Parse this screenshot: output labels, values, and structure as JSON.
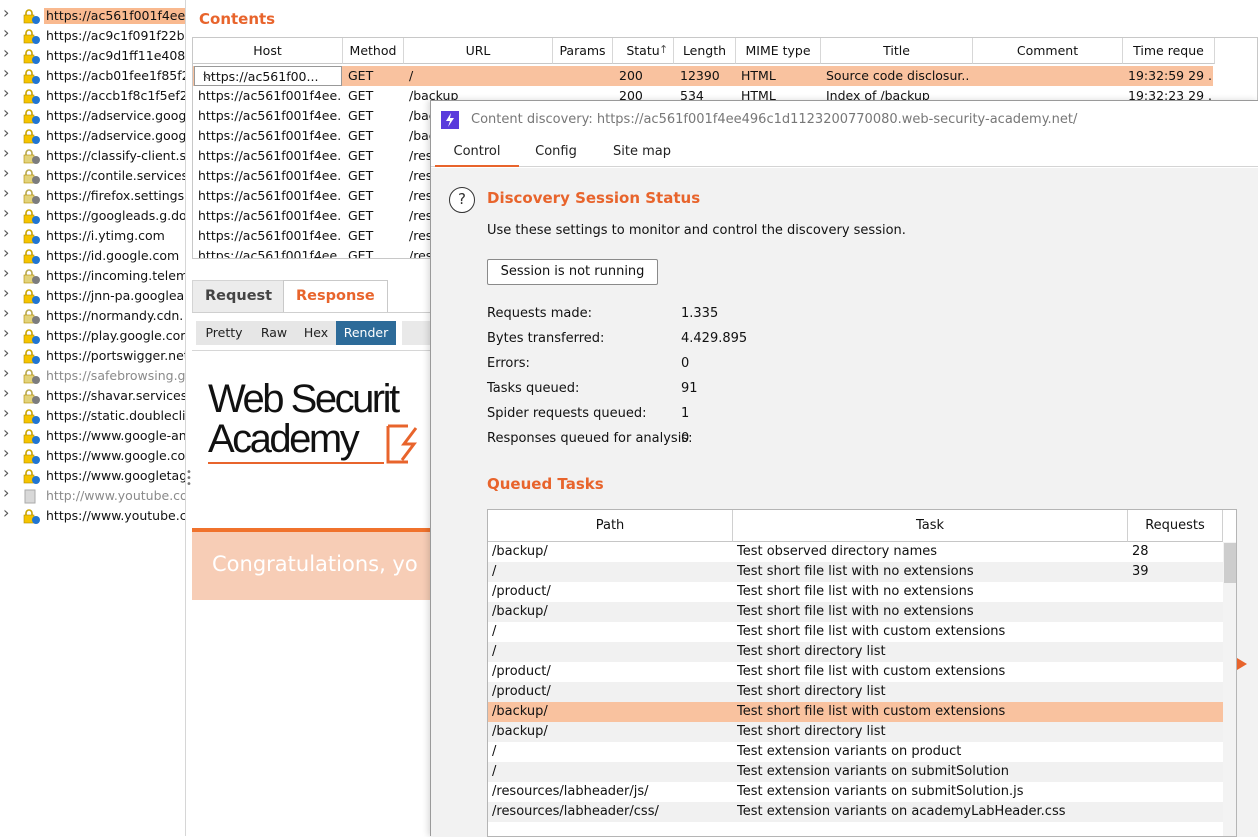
{
  "tree": {
    "items": [
      {
        "label": "https://ac561f001f4ee",
        "selected": true,
        "icon": "lock-icon"
      },
      {
        "label": "https://ac9c1f091f22bl",
        "icon": "lock-icon"
      },
      {
        "label": "https://ac9d1ff11e408",
        "icon": "lock-icon"
      },
      {
        "label": "https://acb01fee1f85f2",
        "icon": "lock-icon"
      },
      {
        "label": "https://accb1f8c1f5ef2",
        "icon": "lock-icon"
      },
      {
        "label": "https://adservice.googl",
        "icon": "lock-icon"
      },
      {
        "label": "https://adservice.googl",
        "icon": "lock-icon"
      },
      {
        "label": "https://classify-client.se",
        "icon": "lock-gray-icon"
      },
      {
        "label": "https://contile.services.",
        "icon": "lock-gray-icon"
      },
      {
        "label": "https://firefox.settings.s",
        "icon": "lock-gray-icon"
      },
      {
        "label": "https://googleads.g.do",
        "icon": "lock-icon"
      },
      {
        "label": "https://i.ytimg.com",
        "icon": "lock-icon"
      },
      {
        "label": "https://id.google.com",
        "icon": "lock-icon"
      },
      {
        "label": "https://incoming.telem",
        "icon": "lock-gray-icon"
      },
      {
        "label": "https://jnn-pa.googlea",
        "icon": "lock-icon"
      },
      {
        "label": "https://normandy.cdn.",
        "icon": "lock-gray-icon"
      },
      {
        "label": "https://play.google.com",
        "icon": "lock-icon"
      },
      {
        "label": "https://portswigger.net",
        "icon": "lock-icon"
      },
      {
        "label": "https://safebrowsing.go",
        "icon": "lock-gray-icon",
        "muted": true
      },
      {
        "label": "https://shavar.services.",
        "icon": "lock-gray-icon"
      },
      {
        "label": "https://static.doubleclic",
        "icon": "lock-icon"
      },
      {
        "label": "https://www.google-an",
        "icon": "lock-icon"
      },
      {
        "label": "https://www.google.co",
        "icon": "lock-icon"
      },
      {
        "label": "https://www.googletag",
        "icon": "lock-icon"
      },
      {
        "label": "http://www.youtube.co",
        "icon": "page-gray-icon",
        "muted": true
      },
      {
        "label": "https://www.youtube.c",
        "icon": "lock-icon"
      }
    ]
  },
  "contents": {
    "title": "Contents",
    "columns": [
      "Host",
      "Method",
      "URL",
      "Params",
      "Statu",
      "Length",
      "MIME type",
      "Title",
      "Comment",
      "Time reque"
    ],
    "sort_indicator": "↑",
    "host_filter": "https://ac561f00...",
    "rows": [
      {
        "host": "",
        "method": "GET",
        "url": "/",
        "status": "200",
        "length": "12390",
        "mime": "HTML",
        "title": "Source code disclosur...",
        "time": "19:32:59 29 ..."
      },
      {
        "host": "https://ac561f001f4ee...",
        "method": "GET",
        "url": "/backup",
        "status": "200",
        "length": "534",
        "mime": "HTML",
        "title": "Index of /backup",
        "time": "19:32:23 29 ..."
      },
      {
        "host": "https://ac561f001f4ee...",
        "method": "GET",
        "url": "/bac",
        "status": "",
        "length": "",
        "mime": "",
        "title": "",
        "time": ""
      },
      {
        "host": "https://ac561f001f4ee...",
        "method": "GET",
        "url": "/bac",
        "status": "",
        "length": "",
        "mime": "",
        "title": "",
        "time": ""
      },
      {
        "host": "https://ac561f001f4ee...",
        "method": "GET",
        "url": "/res",
        "status": "",
        "length": "",
        "mime": "",
        "title": "",
        "time": ""
      },
      {
        "host": "https://ac561f001f4ee...",
        "method": "GET",
        "url": "/res",
        "status": "",
        "length": "",
        "mime": "",
        "title": "",
        "time": ""
      },
      {
        "host": "https://ac561f001f4ee...",
        "method": "GET",
        "url": "/res",
        "status": "",
        "length": "",
        "mime": "",
        "title": "",
        "time": ""
      },
      {
        "host": "https://ac561f001f4ee...",
        "method": "GET",
        "url": "/res",
        "status": "",
        "length": "",
        "mime": "",
        "title": "",
        "time": ""
      },
      {
        "host": "https://ac561f001f4ee...",
        "method": "GET",
        "url": "/res",
        "status": "",
        "length": "",
        "mime": "",
        "title": "",
        "time": ""
      },
      {
        "host": "https://ac561f001f4ee...",
        "method": "GET",
        "url": "/res",
        "status": "",
        "length": "",
        "mime": "",
        "title": "",
        "time": ""
      }
    ]
  },
  "message": {
    "tabs": [
      "Request",
      "Response"
    ],
    "active_tab": "Response",
    "view_buttons": [
      "Pretty",
      "Raw",
      "Hex",
      "Render"
    ],
    "active_view": "Render",
    "render": {
      "logo_line1": "Web Securit",
      "logo_line2": "Academy",
      "congrats": "Congratulations, yo"
    }
  },
  "dialog": {
    "title": "Content discovery: https://ac561f001f4ee496c1d1123200770080.web-security-academy.net/",
    "tabs": [
      "Control",
      "Config",
      "Site map"
    ],
    "active_tab": "Control",
    "status_title": "Discovery Session Status",
    "status_desc": "Use these settings to monitor and control the discovery session.",
    "session_button": "Session is not running",
    "stats": [
      {
        "label": "Requests made:",
        "value": "1.335"
      },
      {
        "label": "Bytes transferred:",
        "value": "4.429.895"
      },
      {
        "label": "Errors:",
        "value": "0"
      },
      {
        "label": "Tasks queued:",
        "value": "91"
      },
      {
        "label": "Spider requests queued:",
        "value": "1"
      },
      {
        "label": "Responses queued for analysis:",
        "value": "0"
      }
    ],
    "queue_title": "Queued Tasks",
    "queue_columns": [
      "Path",
      "Task",
      "Requests"
    ],
    "queue_rows": [
      {
        "path": "/backup/",
        "task": "Test observed directory names",
        "requests": "28"
      },
      {
        "path": "/",
        "task": "Test short file list with no extensions",
        "requests": "39"
      },
      {
        "path": "/product/",
        "task": "Test short file list with no extensions",
        "requests": ""
      },
      {
        "path": "/backup/",
        "task": "Test short file list with no extensions",
        "requests": ""
      },
      {
        "path": "/",
        "task": "Test short file list with custom extensions",
        "requests": ""
      },
      {
        "path": "/",
        "task": "Test short directory list",
        "requests": ""
      },
      {
        "path": "/product/",
        "task": "Test short file list with custom extensions",
        "requests": ""
      },
      {
        "path": "/product/",
        "task": "Test short directory list",
        "requests": ""
      },
      {
        "path": "/backup/",
        "task": "Test short file list with custom extensions",
        "requests": "",
        "selected": true
      },
      {
        "path": "/backup/",
        "task": "Test short directory list",
        "requests": ""
      },
      {
        "path": "/",
        "task": "Test extension variants on product",
        "requests": ""
      },
      {
        "path": "/",
        "task": "Test extension variants on submitSolution",
        "requests": ""
      },
      {
        "path": "/resources/labheader/js/",
        "task": "Test extension variants on submitSolution.js",
        "requests": ""
      },
      {
        "path": "/resources/labheader/css/",
        "task": "Test extension variants on academyLabHeader.css",
        "requests": ""
      }
    ]
  },
  "colors": {
    "accent": "#e8642c",
    "selection": "#f9c29f",
    "render_button": "#2d6b99",
    "burp_logo": "#5a3bdc"
  }
}
